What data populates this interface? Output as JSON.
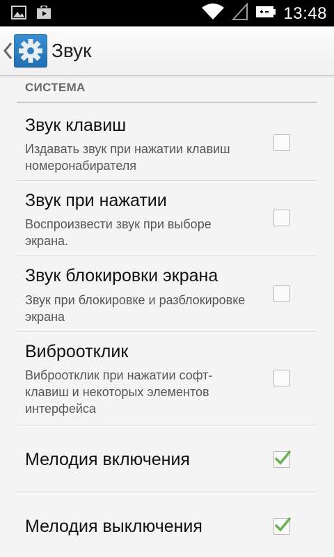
{
  "status_bar": {
    "time": "13:48",
    "icons": [
      "image-icon",
      "play-store-icon",
      "wifi-icon",
      "signal-icon",
      "battery-icon"
    ]
  },
  "action_bar": {
    "title": "Звук",
    "icons": [
      "back-chevron-icon",
      "settings-gear-icon"
    ]
  },
  "section": {
    "header": "СИСТЕМА"
  },
  "preferences": [
    {
      "title": "Звук клавиш",
      "summary": "Издавать звук при нажатии клавиш номеронабирателя",
      "checked": false
    },
    {
      "title": "Звук при нажатии",
      "summary": "Воспроизвести звук при выборе экрана.",
      "checked": false
    },
    {
      "title": "Звук блокировки экрана",
      "summary": "Звук при блокировке и разблокировке экрана",
      "checked": false
    },
    {
      "title": "Виброотклик",
      "summary": "Виброотклик при нажатии софт-клавиш и некоторых элементов интерфейса",
      "checked": false
    },
    {
      "title": "Мелодия включения",
      "summary": "",
      "checked": true
    },
    {
      "title": "Мелодия выключения",
      "summary": "",
      "checked": true
    }
  ],
  "colors": {
    "checkmark": "#6ab04c",
    "app_icon": "#2a7fc4"
  }
}
